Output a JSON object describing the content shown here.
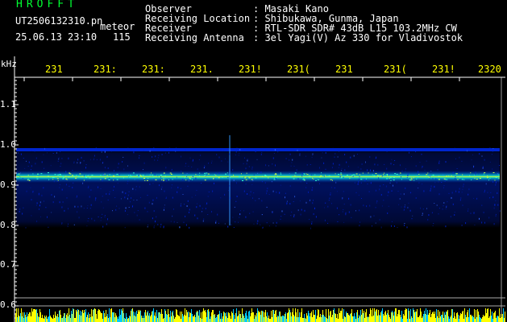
{
  "header": {
    "brand": "HROFFT",
    "filename": "UT2506132310.pn",
    "mode": "meteor",
    "datetime": "25.06.13 23:10",
    "count": "115"
  },
  "station": {
    "labels": [
      "Observer",
      "Receiving Location",
      "Receiver",
      "Receiving Antenna"
    ],
    "values": [
      ": Masaki Kano",
      ": Shibukawa, Gunma, Japan",
      ": RTL-SDR SDR# 43dB L15 103.2MHz CW",
      ": 3el Yagi(V) Az 330 for Vladivostok"
    ]
  },
  "axes": {
    "y_unit": "kHz",
    "y_ticks": [
      "1.1",
      "1.0",
      "0.9",
      "0.8",
      "0.7",
      "0.6"
    ],
    "time_ticks": [
      "231",
      "231:",
      "231:",
      "231.",
      "231!",
      "231(",
      "231",
      "231(",
      "231!",
      "2320"
    ]
  },
  "colors": {
    "background": "#000000",
    "text": "#ffffff",
    "ticks": "#ffff00",
    "brand": "#00ff33",
    "signal": "#ffff00",
    "noise": "#0022ff"
  }
}
